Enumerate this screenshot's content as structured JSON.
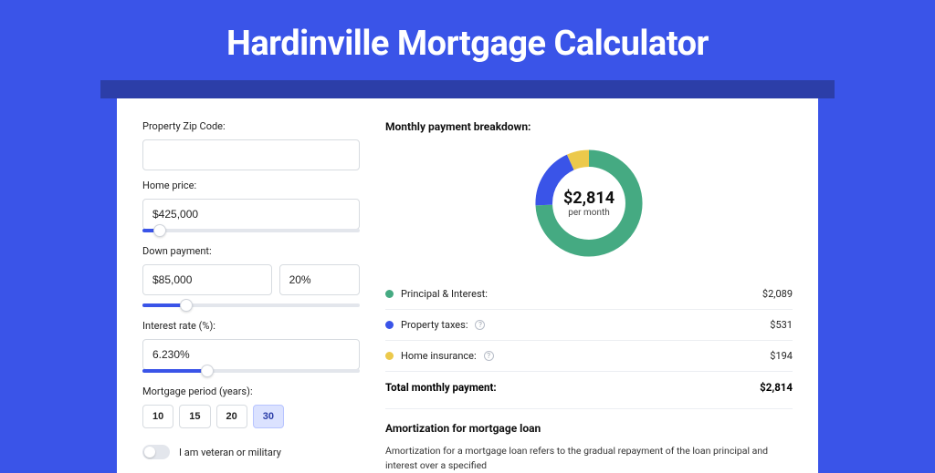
{
  "title": "Hardinville Mortgage Calculator",
  "colors": {
    "principal": "#45aa82",
    "taxes": "#3a54e8",
    "insurance": "#ecc94b"
  },
  "form": {
    "zip": {
      "label": "Property Zip Code:",
      "value": ""
    },
    "home_price": {
      "label": "Home price:",
      "value": "$425,000",
      "slider_pct": 8
    },
    "down_payment": {
      "label": "Down payment:",
      "value": "$85,000",
      "pct_value": "20%",
      "slider_pct": 20
    },
    "interest": {
      "label": "Interest rate (%):",
      "value": "6.230%",
      "slider_pct": 30
    },
    "period": {
      "label": "Mortgage period (years):",
      "options": [
        "10",
        "15",
        "20",
        "30"
      ],
      "active": "30"
    },
    "veteran": {
      "label": "I am veteran or military",
      "on": false
    }
  },
  "breakdown": {
    "heading": "Monthly payment breakdown:",
    "center_amount": "$2,814",
    "center_sub": "per month",
    "rows": [
      {
        "label": "Principal & Interest:",
        "value": "$2,089",
        "color_key": "principal",
        "info": false
      },
      {
        "label": "Property taxes:",
        "value": "$531",
        "color_key": "taxes",
        "info": true
      },
      {
        "label": "Home insurance:",
        "value": "$194",
        "color_key": "insurance",
        "info": true
      }
    ],
    "total_label": "Total monthly payment:",
    "total_value": "$2,814"
  },
  "amortization": {
    "heading": "Amortization for mortgage loan",
    "text": "Amortization for a mortgage loan refers to the gradual repayment of the loan principal and interest over a specified"
  },
  "chart_data": {
    "type": "pie",
    "title": "Monthly payment breakdown",
    "series": [
      {
        "name": "Principal & Interest",
        "value": 2089
      },
      {
        "name": "Property taxes",
        "value": 531
      },
      {
        "name": "Home insurance",
        "value": 194
      }
    ],
    "total": 2814
  }
}
